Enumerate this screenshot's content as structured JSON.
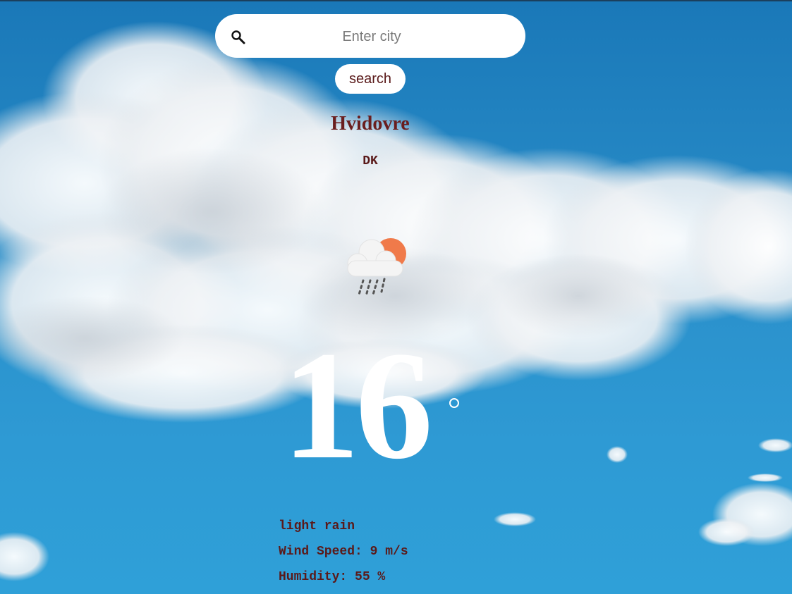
{
  "search": {
    "placeholder": "Enter city",
    "value": "",
    "button_label": "search",
    "icon": "search-icon"
  },
  "location": {
    "city": "Hvidovre",
    "country": "DK"
  },
  "weather": {
    "icon": "cloud-sun-rain-icon",
    "temperature": "16",
    "description": "light rain",
    "wind_speed_label": "Wind Speed: 9 m/s",
    "humidity_label": "Humidity: 55 %"
  },
  "colors": {
    "sky": "#2a8fca",
    "text_dark_red": "#6a1e1e",
    "sun": "#f07a4a",
    "cloud": "#f4f4f4"
  }
}
